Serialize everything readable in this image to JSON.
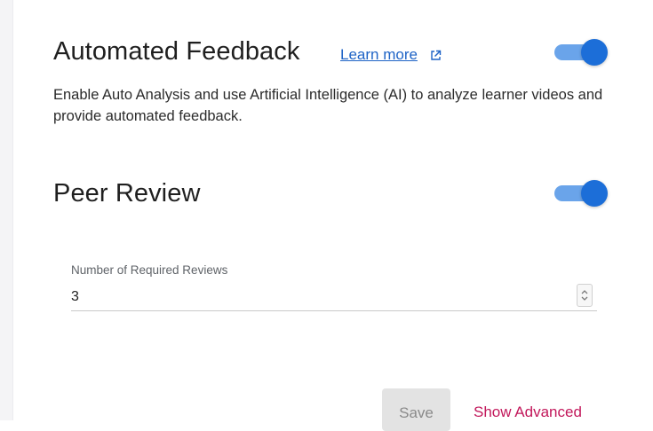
{
  "automated_feedback": {
    "title": "Automated Feedback",
    "learn_more": "Learn more",
    "description": "Enable Auto Analysis and use Artificial Intelligence (AI) to analyze learner videos and provide automated feedback.",
    "enabled": true
  },
  "peer_review": {
    "title": "Peer Review",
    "enabled": true,
    "required_reviews": {
      "label": "Number of Required Reviews",
      "value": "3"
    }
  },
  "footer": {
    "save_label": "Save",
    "show_advanced_label": "Show Advanced"
  },
  "colors": {
    "toggle_on": "#1c6ed8",
    "link": "#1e63c6",
    "advanced_link": "#c2185b"
  },
  "icons": {
    "external_link": "external-link-icon",
    "stepper": "up-down-chevron-icon"
  }
}
